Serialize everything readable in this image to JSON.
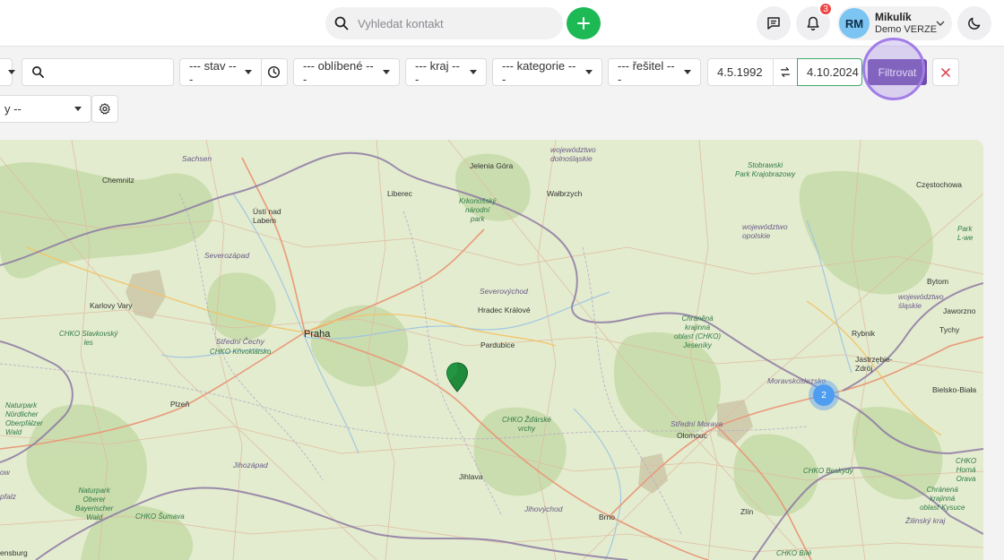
{
  "header": {
    "search_placeholder": "Vyhledat kontakt",
    "notifications_count": "3",
    "user": {
      "initials": "RM",
      "name": "Mikulík",
      "organization": "Demo VERZE"
    }
  },
  "filters": {
    "state_select": "--- stav ---",
    "favorites_select": "--- oblíbené ---",
    "region_select": "--- kraj ---",
    "category_select": "--- kategorie ---",
    "assignee_select": "--- řešitel ---",
    "date_from": "4.5.1992",
    "date_to": "4.10.2024",
    "filter_label": "Filtrovat",
    "second_row_select": "y --"
  },
  "map": {
    "labels": {
      "sachsen": "Sachsen",
      "chemnitz": "Chemnitz",
      "usti": "Ústí nad\nLabem",
      "liberec": "Liberec",
      "jelenia": "Jelenia Góra",
      "dolnoslaskie": "województwo\ndolnośląskie",
      "walbrzych": "Wałbrzych",
      "krkonose": "Krkonošský\nnárodní\npark",
      "stobrawski": "Stobrawski\nPark Krajobrazowy",
      "czestochowa": "Częstochowa",
      "opolskie": "województwo\nopolskie",
      "park_r": "Park\nL-we",
      "severozapad": "Severozápad",
      "severovychod": "Severovýchod",
      "hradec": "Hradec Králové",
      "karlovy": "Karlovy Vary",
      "chko_slavkov": "CHKO Slavkovský\nles",
      "stredni_cechy": "Střední Čechy",
      "chko_krivoklat": "CHKO Křivoklátsko",
      "praha": "Praha",
      "pardubice": "Pardubice",
      "chko_jeseniky": "Chráněná\nkrajinná\noblast (CHKO)\nJeseníky",
      "bytom": "Bytom",
      "slaskie": "województwo\nśląskie",
      "jaworzno": "Jaworzno",
      "rybnik": "Rybnik",
      "tychy": "Tychy",
      "jastrzebie": "Jastrzębie-\nZdrój",
      "moravskoslezsko": "Moravskoslezsko",
      "bielsko": "Bielsko-Biała",
      "naturpark": "Naturpark\nNördlicher\nOberpfälzer\nWald",
      "plzen": "Plzeň",
      "chko_zdarske": "CHKO Žďárské\nvrchy",
      "stredni_morava": "Střední Morava",
      "olomouc": "Olomouc",
      "chko_beskydy": "CHKO Beskydy",
      "chko_horna": "CHKO\nHorná\nOrava",
      "chranena_kysuce": "Chránená\nkrajinná\noblasť Kysuce",
      "jihozapad": "Jihozápad",
      "jihlava": "Jihlava",
      "naturpark_bay": "Naturpark\nOberer\nBayerischer\nWald",
      "jihovychod": "Jihovýchod",
      "chko_sumava": "CHKO Šumava",
      "brno": "Brno",
      "zlin": "Zlín",
      "zilinsky": "Žilinský kraj",
      "chko_bile": "CHKO Bílé",
      "ensburg": "ensburg",
      "pfalz": "pfalz",
      "ow": "ow"
    },
    "cluster_count": "2"
  }
}
